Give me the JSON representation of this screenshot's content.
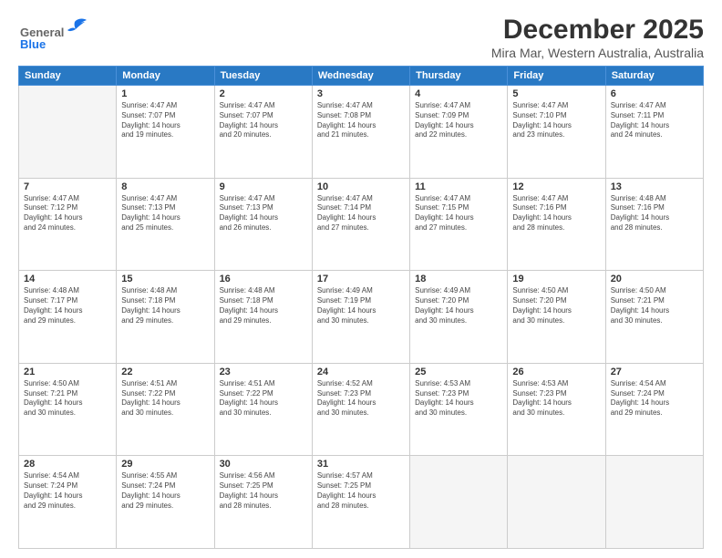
{
  "header": {
    "logo_general": "General",
    "logo_blue": "Blue",
    "title": "December 2025",
    "subtitle": "Mira Mar, Western Australia, Australia"
  },
  "columns": [
    "Sunday",
    "Monday",
    "Tuesday",
    "Wednesday",
    "Thursday",
    "Friday",
    "Saturday"
  ],
  "weeks": [
    [
      {
        "day": "",
        "info": ""
      },
      {
        "day": "1",
        "info": "Sunrise: 4:47 AM\nSunset: 7:07 PM\nDaylight: 14 hours\nand 19 minutes."
      },
      {
        "day": "2",
        "info": "Sunrise: 4:47 AM\nSunset: 7:07 PM\nDaylight: 14 hours\nand 20 minutes."
      },
      {
        "day": "3",
        "info": "Sunrise: 4:47 AM\nSunset: 7:08 PM\nDaylight: 14 hours\nand 21 minutes."
      },
      {
        "day": "4",
        "info": "Sunrise: 4:47 AM\nSunset: 7:09 PM\nDaylight: 14 hours\nand 22 minutes."
      },
      {
        "day": "5",
        "info": "Sunrise: 4:47 AM\nSunset: 7:10 PM\nDaylight: 14 hours\nand 23 minutes."
      },
      {
        "day": "6",
        "info": "Sunrise: 4:47 AM\nSunset: 7:11 PM\nDaylight: 14 hours\nand 24 minutes."
      }
    ],
    [
      {
        "day": "7",
        "info": "Sunrise: 4:47 AM\nSunset: 7:12 PM\nDaylight: 14 hours\nand 24 minutes."
      },
      {
        "day": "8",
        "info": "Sunrise: 4:47 AM\nSunset: 7:13 PM\nDaylight: 14 hours\nand 25 minutes."
      },
      {
        "day": "9",
        "info": "Sunrise: 4:47 AM\nSunset: 7:13 PM\nDaylight: 14 hours\nand 26 minutes."
      },
      {
        "day": "10",
        "info": "Sunrise: 4:47 AM\nSunset: 7:14 PM\nDaylight: 14 hours\nand 27 minutes."
      },
      {
        "day": "11",
        "info": "Sunrise: 4:47 AM\nSunset: 7:15 PM\nDaylight: 14 hours\nand 27 minutes."
      },
      {
        "day": "12",
        "info": "Sunrise: 4:47 AM\nSunset: 7:16 PM\nDaylight: 14 hours\nand 28 minutes."
      },
      {
        "day": "13",
        "info": "Sunrise: 4:48 AM\nSunset: 7:16 PM\nDaylight: 14 hours\nand 28 minutes."
      }
    ],
    [
      {
        "day": "14",
        "info": "Sunrise: 4:48 AM\nSunset: 7:17 PM\nDaylight: 14 hours\nand 29 minutes."
      },
      {
        "day": "15",
        "info": "Sunrise: 4:48 AM\nSunset: 7:18 PM\nDaylight: 14 hours\nand 29 minutes."
      },
      {
        "day": "16",
        "info": "Sunrise: 4:48 AM\nSunset: 7:18 PM\nDaylight: 14 hours\nand 29 minutes."
      },
      {
        "day": "17",
        "info": "Sunrise: 4:49 AM\nSunset: 7:19 PM\nDaylight: 14 hours\nand 30 minutes."
      },
      {
        "day": "18",
        "info": "Sunrise: 4:49 AM\nSunset: 7:20 PM\nDaylight: 14 hours\nand 30 minutes."
      },
      {
        "day": "19",
        "info": "Sunrise: 4:50 AM\nSunset: 7:20 PM\nDaylight: 14 hours\nand 30 minutes."
      },
      {
        "day": "20",
        "info": "Sunrise: 4:50 AM\nSunset: 7:21 PM\nDaylight: 14 hours\nand 30 minutes."
      }
    ],
    [
      {
        "day": "21",
        "info": "Sunrise: 4:50 AM\nSunset: 7:21 PM\nDaylight: 14 hours\nand 30 minutes."
      },
      {
        "day": "22",
        "info": "Sunrise: 4:51 AM\nSunset: 7:22 PM\nDaylight: 14 hours\nand 30 minutes."
      },
      {
        "day": "23",
        "info": "Sunrise: 4:51 AM\nSunset: 7:22 PM\nDaylight: 14 hours\nand 30 minutes."
      },
      {
        "day": "24",
        "info": "Sunrise: 4:52 AM\nSunset: 7:23 PM\nDaylight: 14 hours\nand 30 minutes."
      },
      {
        "day": "25",
        "info": "Sunrise: 4:53 AM\nSunset: 7:23 PM\nDaylight: 14 hours\nand 30 minutes."
      },
      {
        "day": "26",
        "info": "Sunrise: 4:53 AM\nSunset: 7:23 PM\nDaylight: 14 hours\nand 30 minutes."
      },
      {
        "day": "27",
        "info": "Sunrise: 4:54 AM\nSunset: 7:24 PM\nDaylight: 14 hours\nand 29 minutes."
      }
    ],
    [
      {
        "day": "28",
        "info": "Sunrise: 4:54 AM\nSunset: 7:24 PM\nDaylight: 14 hours\nand 29 minutes."
      },
      {
        "day": "29",
        "info": "Sunrise: 4:55 AM\nSunset: 7:24 PM\nDaylight: 14 hours\nand 29 minutes."
      },
      {
        "day": "30",
        "info": "Sunrise: 4:56 AM\nSunset: 7:25 PM\nDaylight: 14 hours\nand 28 minutes."
      },
      {
        "day": "31",
        "info": "Sunrise: 4:57 AM\nSunset: 7:25 PM\nDaylight: 14 hours\nand 28 minutes."
      },
      {
        "day": "",
        "info": ""
      },
      {
        "day": "",
        "info": ""
      },
      {
        "day": "",
        "info": ""
      }
    ]
  ]
}
